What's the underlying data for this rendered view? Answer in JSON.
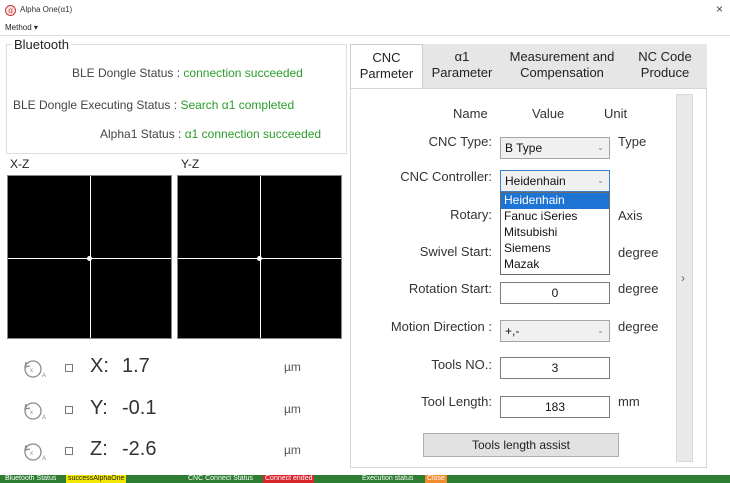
{
  "window": {
    "title": "Alpha One(α1)",
    "close_glyph": "×",
    "icon": "alpha-app-icon"
  },
  "menu": {
    "method": "Method ▾"
  },
  "bluetooth": {
    "title": "Bluetooth",
    "rows": [
      {
        "label": "BLE Dongle Status :",
        "value": "connection succeeded"
      },
      {
        "label": "BLE Dongle Executing Status :",
        "value": "Search α1 completed"
      },
      {
        "label": "Alpha1 Status :",
        "value": "α1 connection succeeded"
      }
    ],
    "value_color": "#2a9d2a"
  },
  "plots": {
    "xz_title": "X-Z",
    "yz_title": "Y-Z"
  },
  "axes": [
    {
      "name": "X:",
      "value": "1.7",
      "unit": "µm"
    },
    {
      "name": "Y:",
      "value": "-0.1",
      "unit": "µm"
    },
    {
      "name": "Z:",
      "value": "-2.6",
      "unit": "µm"
    }
  ],
  "tabs": [
    {
      "line1": "CNC",
      "line2": "Parmeter",
      "active": true
    },
    {
      "line1": "α1",
      "line2": "Parameter",
      "active": false
    },
    {
      "line1": "Measurement and",
      "line2": "Compensation",
      "active": false
    },
    {
      "line1": "NC Code",
      "line2": "Produce",
      "active": false
    }
  ],
  "params": {
    "headers": {
      "name": "Name",
      "value": "Value",
      "unit": "Unit"
    },
    "cnc_type": {
      "label": "CNC Type:",
      "value": "B Type",
      "unit": "Type"
    },
    "cnc_controller": {
      "label": "CNC Controller:",
      "value": "Heidenhain"
    },
    "rotary": {
      "label": "Rotary:",
      "unit": "Axis"
    },
    "swivel_start": {
      "label": "Swivel Start:",
      "unit": "degree"
    },
    "rotation_start": {
      "label": "Rotation Start:",
      "value": "0",
      "unit": "degree"
    },
    "motion_direction": {
      "label": "Motion Direction :",
      "value": "+,-",
      "unit": "degree"
    },
    "tools_no": {
      "label": "Tools NO.:",
      "value": "3"
    },
    "tool_length": {
      "label": "Tool Length:",
      "value": "183",
      "unit": "mm"
    },
    "assist_button": "Tools length assist"
  },
  "controller_options": [
    "Heidenhain",
    "Fanuc iSeries",
    "Mitsubishi",
    "Siemens",
    "Mazak"
  ],
  "scroll_arrow": "›",
  "status_bar": {
    "bt_label": "Bluetooth Status",
    "bt_value": "successAlphaOne",
    "cnc_label": "CNC Connect Status",
    "cnc_value": "Connect ended",
    "exec_label": "Execution status",
    "exec_value": "Close",
    "colors": {
      "bar": "#2e7d32",
      "bt": "#f3e600",
      "cnc": "#d9262b",
      "exec": "#f28b2c"
    }
  }
}
